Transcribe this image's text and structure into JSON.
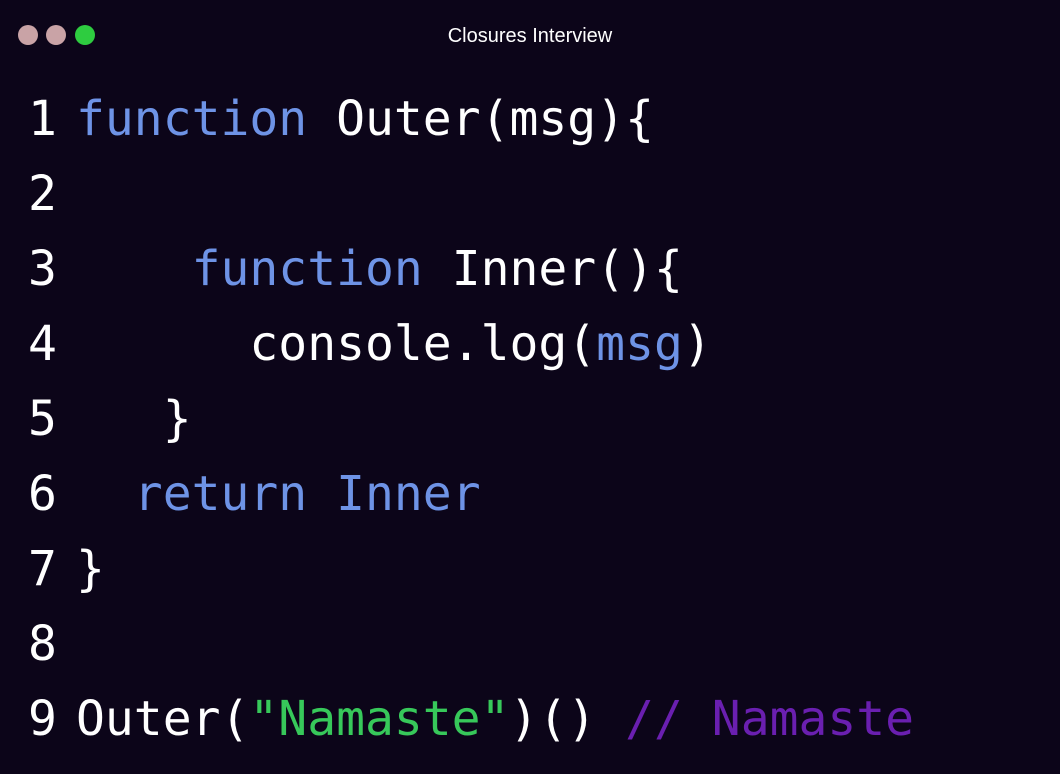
{
  "window": {
    "title": "Closures Interview",
    "traffic_lights": [
      {
        "name": "close",
        "color": "#c9a3a6"
      },
      {
        "name": "minimize",
        "color": "#c9a3a6"
      },
      {
        "name": "maximize",
        "color": "#2ecc40"
      }
    ]
  },
  "theme": {
    "background": "#0c0519",
    "keyword": "#6e93e6",
    "identifier": "#ffffff",
    "string": "#37c85a",
    "comment": "#6a1fb0"
  },
  "code": {
    "lines": [
      {
        "number": "1",
        "tokens": [
          {
            "t": "function",
            "k": "kw"
          },
          {
            "t": " ",
            "k": "pn"
          },
          {
            "t": "Outer(msg){",
            "k": "id"
          }
        ]
      },
      {
        "number": "2",
        "tokens": []
      },
      {
        "number": "3",
        "tokens": [
          {
            "t": "    ",
            "k": "pn"
          },
          {
            "t": "function",
            "k": "kw"
          },
          {
            "t": " ",
            "k": "pn"
          },
          {
            "t": "Inner(){",
            "k": "id"
          }
        ]
      },
      {
        "number": "4",
        "tokens": [
          {
            "t": "      ",
            "k": "pn"
          },
          {
            "t": "console.log(",
            "k": "id"
          },
          {
            "t": "msg",
            "k": "kw"
          },
          {
            "t": ")",
            "k": "id"
          }
        ]
      },
      {
        "number": "5",
        "tokens": [
          {
            "t": "   ",
            "k": "pn"
          },
          {
            "t": "}",
            "k": "id"
          }
        ]
      },
      {
        "number": "6",
        "tokens": [
          {
            "t": "  ",
            "k": "pn"
          },
          {
            "t": "return",
            "k": "kw"
          },
          {
            "t": " ",
            "k": "pn"
          },
          {
            "t": "Inner",
            "k": "kw"
          }
        ]
      },
      {
        "number": "7",
        "tokens": [
          {
            "t": "}",
            "k": "id"
          }
        ]
      },
      {
        "number": "8",
        "tokens": []
      },
      {
        "number": "9",
        "tokens": [
          {
            "t": "Outer(",
            "k": "id"
          },
          {
            "t": "\"Namaste\"",
            "k": "str"
          },
          {
            "t": ")()",
            "k": "id"
          },
          {
            "t": " ",
            "k": "pn"
          },
          {
            "t": "// Namaste",
            "k": "cm"
          }
        ]
      }
    ]
  }
}
